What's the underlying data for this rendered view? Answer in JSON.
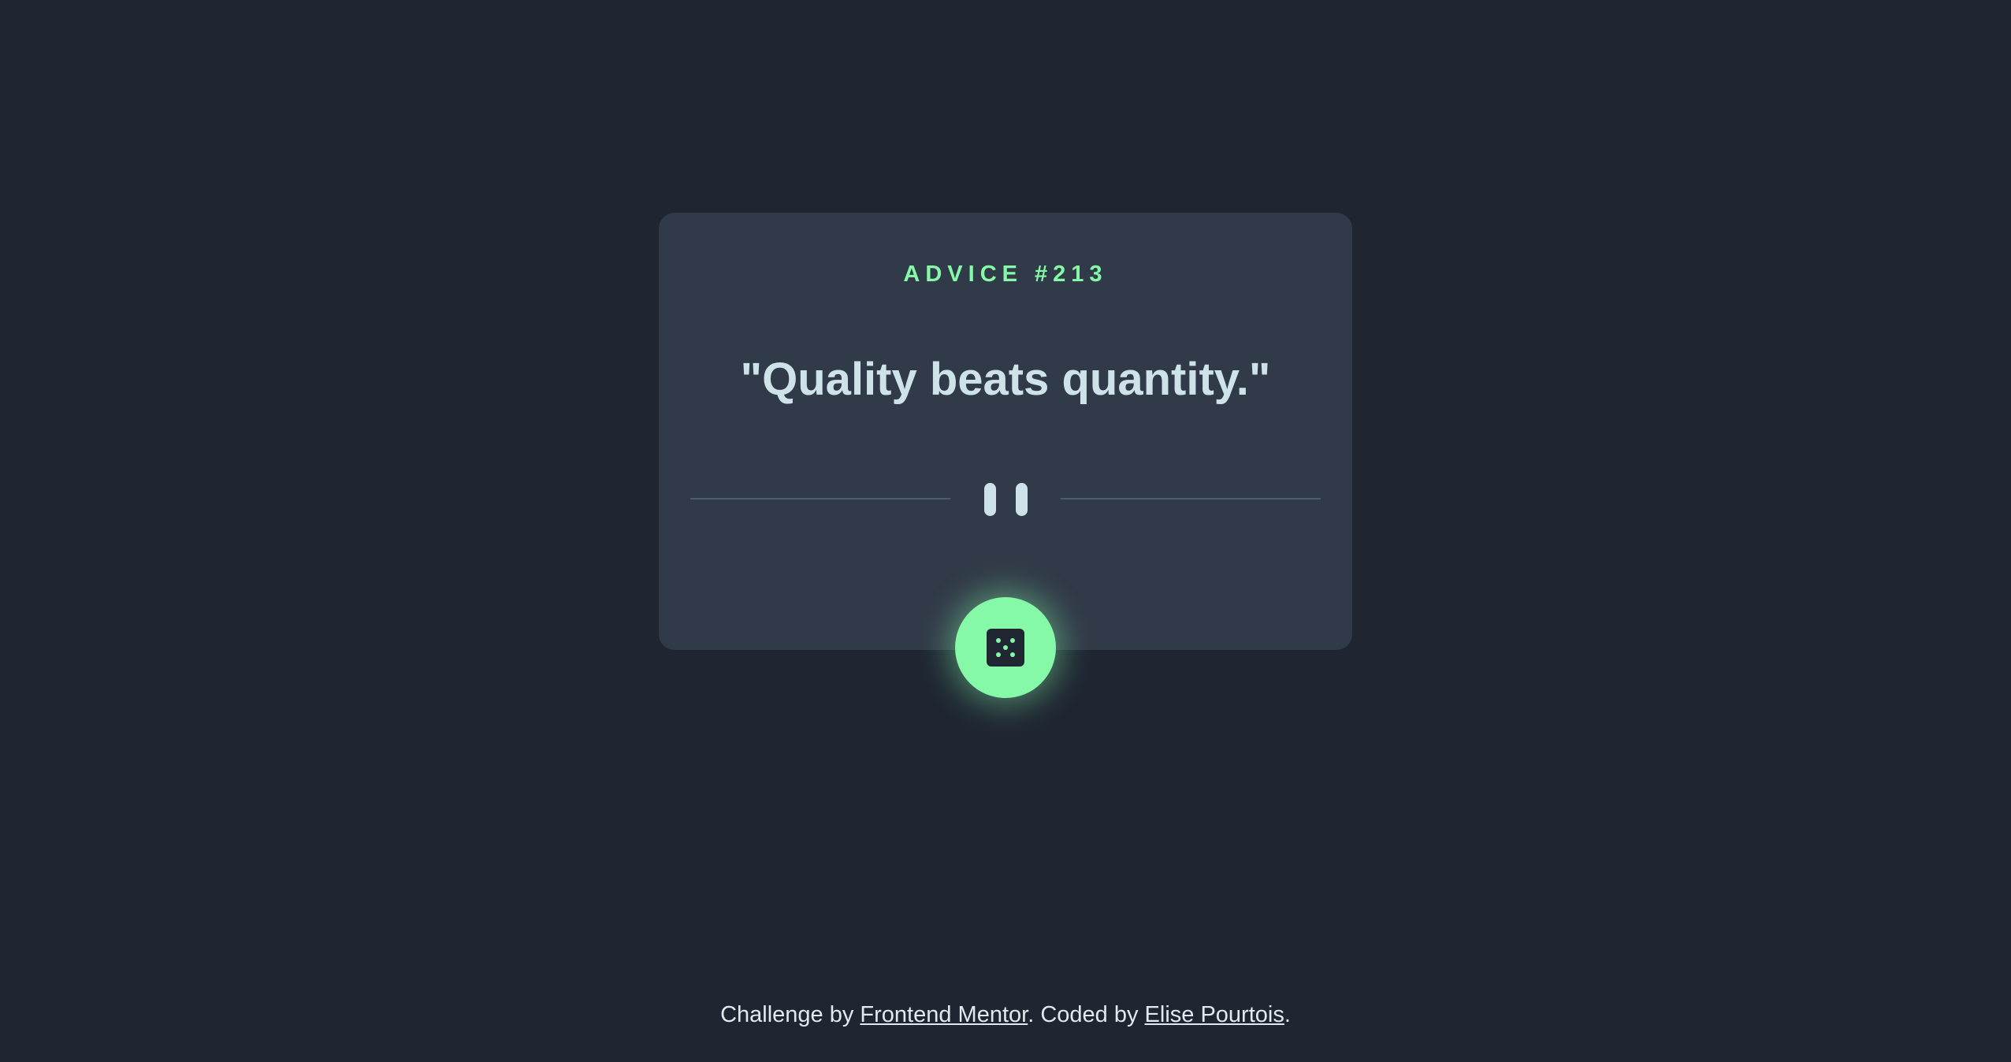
{
  "card": {
    "advice_label": "ADVICE #213",
    "quote": "\"Quality beats quantity.\""
  },
  "divider": {
    "icon": "pause-icon"
  },
  "dice_button": {
    "icon": "dice-icon"
  },
  "footer": {
    "prefix": "Challenge by ",
    "link_frontend_mentor": "Frontend Mentor",
    "middle": ". Coded by ",
    "link_author": "Elise Pourtois",
    "suffix": "."
  },
  "colors": {
    "background": "#1F2632",
    "card": "#313A48",
    "accent": "#86F9A8",
    "quote_text": "#CEE3E9"
  }
}
